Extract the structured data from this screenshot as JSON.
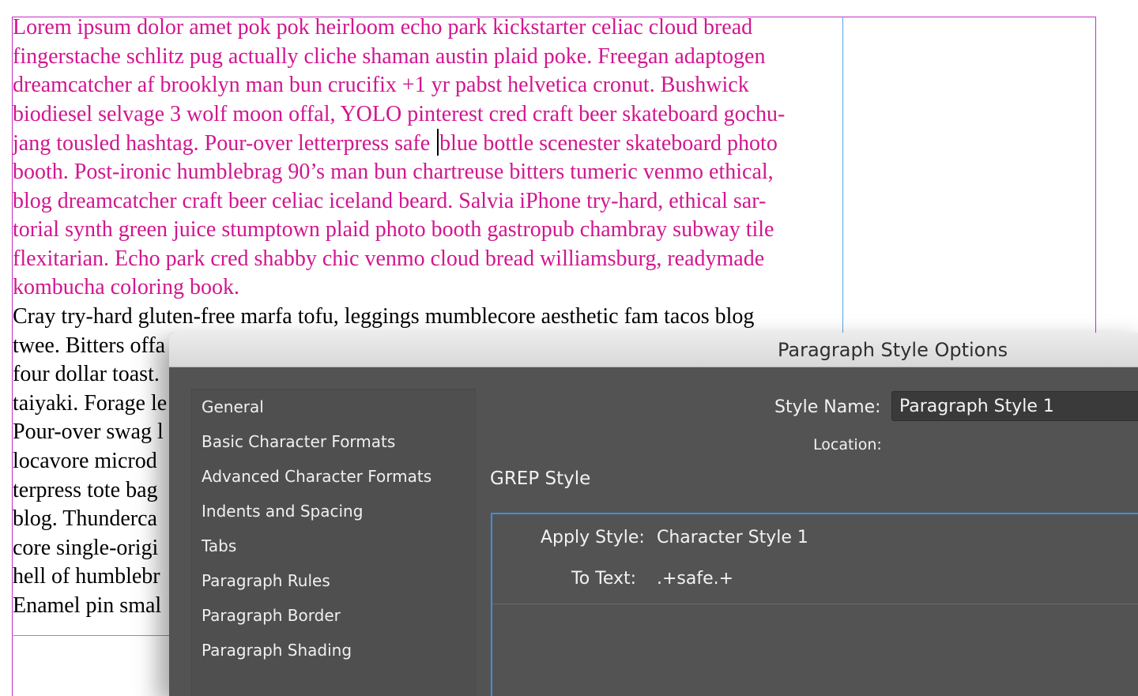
{
  "document": {
    "pink_lines": [
      "Lorem ipsum dolor amet pok pok heirloom echo park kickstarter celiac cloud bread",
      "fingerstache schlitz pug actually cliche shaman austin plaid poke. Freegan adaptogen",
      "dreamcatcher af brooklyn man bun crucifix +1 yr pabst helvetica cronut. Bushwick",
      "biodiesel selvage 3 wolf moon offal, YOLO pinterest cred craft beer skateboard gochu-",
      "jang tousled hashtag. Pour-over letterpress safe ",
      "blue bottle scenester skateboard photo",
      "booth. Post-ironic humblebrag 90’s man bun chartreuse bitters tumeric venmo ethical,",
      "blog dreamcatcher craft beer celiac iceland beard. Salvia iPhone try-hard, ethical sar-",
      "torial synth green juice stumptown plaid photo booth gastropub chambray subway tile",
      "flexitarian. Echo park cred shabby chic venmo cloud bread williamsburg, readymade",
      "kombucha coloring book."
    ],
    "black_lines": [
      "Cray try-hard gluten-free marfa tofu, leggings mumblecore aesthetic fam tacos blog",
      "twee. Bitters offa",
      "four dollar toast.",
      "taiyaki. Forage le",
      "Pour-over swag l",
      "locavore microd",
      "terpress tote bag",
      "blog. Thunderca",
      "core single-origi",
      "hell of humblebr",
      "Enamel pin smal"
    ]
  },
  "dialog": {
    "title": "Paragraph Style Options",
    "sidebar_items": [
      "General",
      "Basic Character Formats",
      "Advanced Character Formats",
      "Indents and Spacing",
      "Tabs",
      "Paragraph Rules",
      "Paragraph Border",
      "Paragraph Shading"
    ],
    "style_name_label": "Style Name:",
    "style_name_value": "Paragraph Style 1",
    "location_label": "Location:",
    "section_title": "GREP Style",
    "grep_rule": {
      "apply_style_label": "Apply Style:",
      "apply_style_value": "Character Style 1",
      "to_text_label": "To Text:",
      "to_text_value": ".+safe.+"
    }
  },
  "colors": {
    "pink_text": "#d1168f",
    "frame_magenta": "#c72fc2",
    "frame_blue": "#5aa0e6",
    "dialog_bg": "#535353",
    "grep_border": "#3f8de0"
  }
}
